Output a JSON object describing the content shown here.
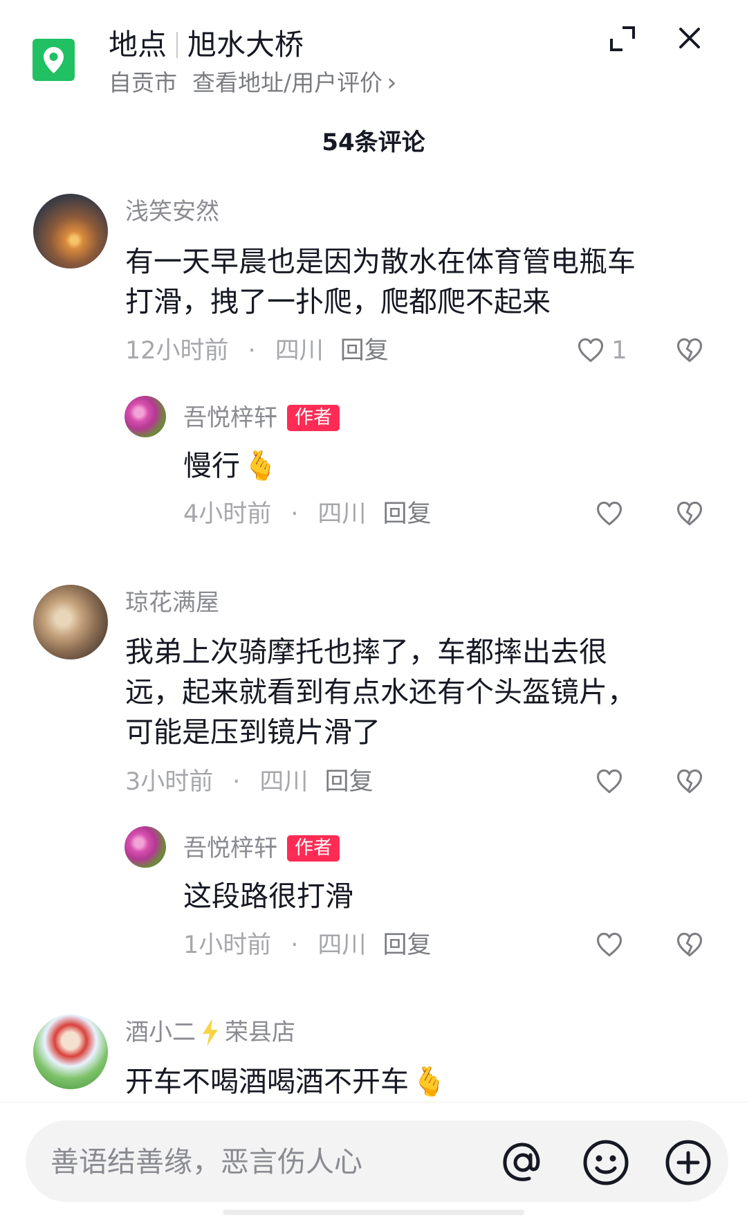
{
  "header": {
    "section_label": "地点",
    "place_name": "旭水大桥",
    "city": "自贡市",
    "view_link": "查看地址/用户评价",
    "chevron": "›"
  },
  "comment_count": "54条评论",
  "comments": [
    {
      "user": "浅笑安然",
      "text_line1": "有一天早晨也是因为散水在体育管电瓶车",
      "text_line2": "打滑，拽了一扑爬，爬都爬不起来",
      "time": "12小时前",
      "region": "四川",
      "reply": "回复",
      "likes": "1",
      "sep": "·",
      "replies": [
        {
          "user": "吾悦梓轩",
          "badge": "作者",
          "text": "慢行",
          "emoji": "🫰",
          "time": "4小时前",
          "region": "四川",
          "reply": "回复",
          "sep": "·"
        }
      ]
    },
    {
      "user": "琼花满屋",
      "text_line1": "我弟上次骑摩托也摔了，车都摔出去很",
      "text_line2": "远，起来就看到有点水还有个头盔镜片，",
      "text_line3": "可能是压到镜片滑了",
      "time": "3小时前",
      "region": "四川",
      "reply": "回复",
      "sep": "·",
      "replies": [
        {
          "user": "吾悦梓轩",
          "badge": "作者",
          "text": "这段路很打滑",
          "time": "1小时前",
          "region": "四川",
          "reply": "回复",
          "sep": "·"
        }
      ]
    },
    {
      "user_part1": "酒小二",
      "user_part2": "荣县店",
      "text": "开车不喝酒喝酒不开车",
      "emoji": "🫰"
    }
  ],
  "input": {
    "placeholder": "善语结善缘，恶言伤人心"
  },
  "icons": {
    "location": "map-pin-icon",
    "expand": "expand-icon",
    "close": "close-icon",
    "like": "heart-outline-icon",
    "dislike": "broken-heart-icon",
    "mention": "at-icon",
    "emoji": "smiley-icon",
    "add": "plus-circle-icon"
  },
  "colors": {
    "brand_green": "#21c063",
    "author_badge": "#fe2c55",
    "text_primary": "#161823",
    "text_secondary": "#8a8b91"
  }
}
